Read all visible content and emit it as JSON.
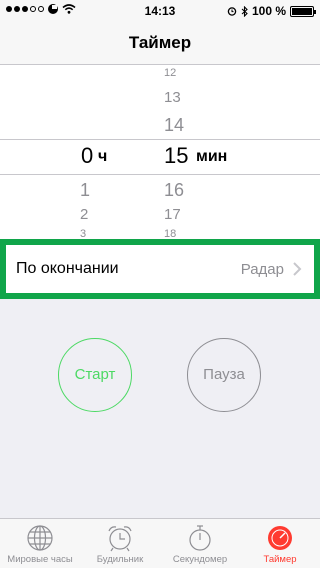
{
  "status_bar": {
    "time": "14:13",
    "battery": "100 %",
    "battery_level": 1.0
  },
  "nav": {
    "title": "Таймер"
  },
  "picker": {
    "hours_above": [],
    "hour_selected": "0",
    "hour_unit": "ч",
    "hours_below": [
      "1",
      "2",
      "3"
    ],
    "minutes_above": [
      "12",
      "13",
      "14"
    ],
    "minute_selected": "15",
    "minute_unit": "мин",
    "minutes_below": [
      "16",
      "17",
      "18"
    ]
  },
  "on_end": {
    "label": "По окончании",
    "value": "Радар"
  },
  "buttons": {
    "start": "Старт",
    "pause": "Пауза"
  },
  "tabs": [
    {
      "label": "Мировые часы",
      "icon": "globe-icon",
      "active": false
    },
    {
      "label": "Будильник",
      "icon": "alarm-clock-icon",
      "active": false
    },
    {
      "label": "Секундомер",
      "icon": "stopwatch-icon",
      "active": false
    },
    {
      "label": "Таймер",
      "icon": "timer-icon",
      "active": true
    }
  ],
  "colors": {
    "start": "#4cd964",
    "pause": "#8e8e93",
    "active_tab": "#ff3b30",
    "highlight": "#10a54a"
  }
}
